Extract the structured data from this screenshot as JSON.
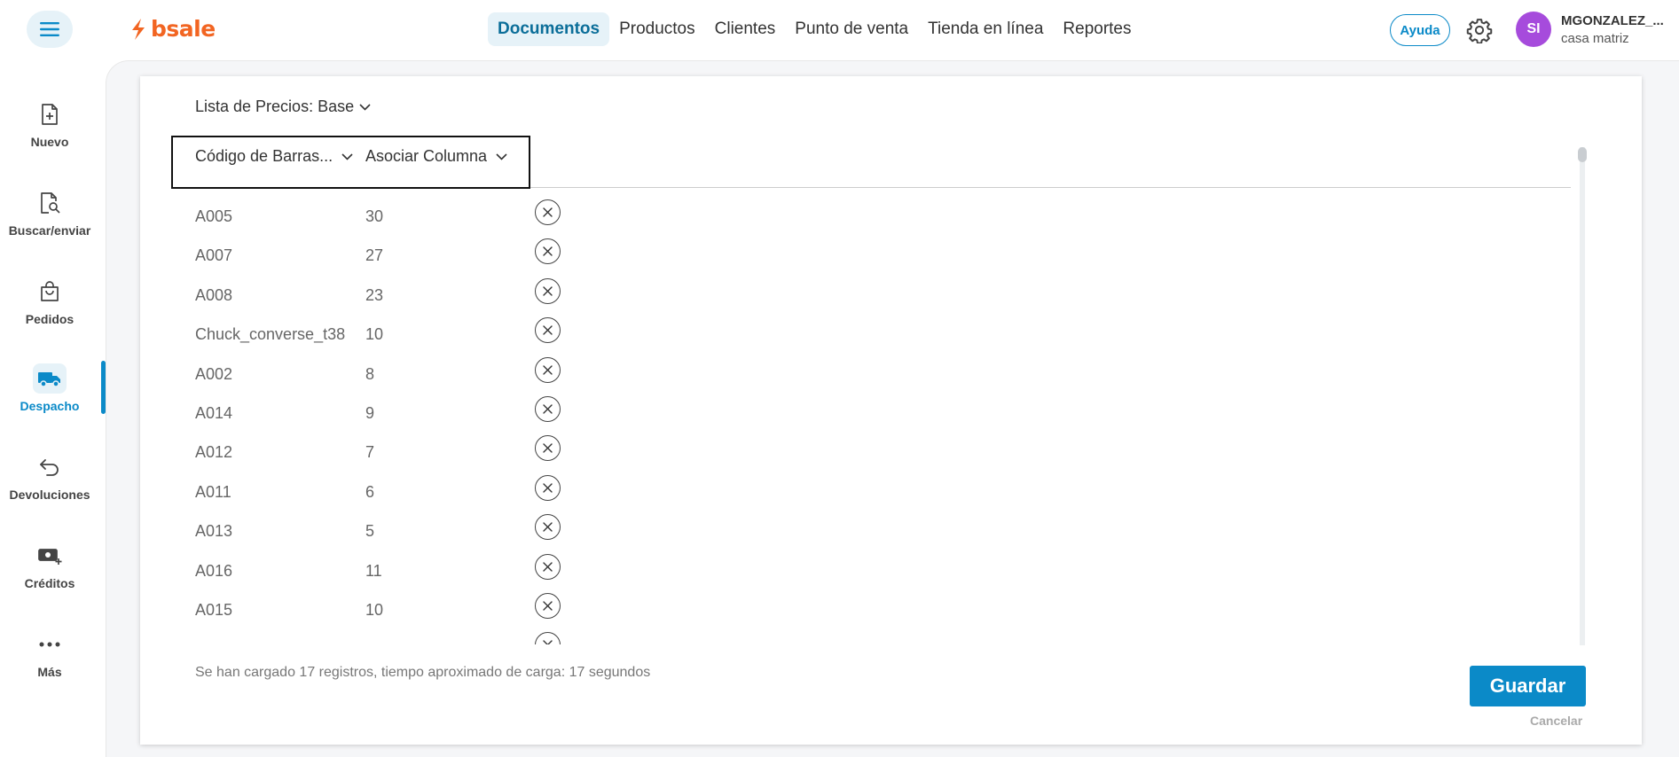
{
  "topbar": {
    "logo_text": "bsale",
    "nav": [
      "Documentos",
      "Productos",
      "Clientes",
      "Punto de venta",
      "Tienda en línea",
      "Reportes"
    ],
    "active_nav": "Documentos",
    "help_label": "Ayuda",
    "user": {
      "initials": "SI",
      "name": "MGONZALEZ_...",
      "branch": "casa matriz"
    }
  },
  "sidebar": {
    "items": [
      {
        "label": "Nuevo",
        "icon": "new-document-icon"
      },
      {
        "label": "Buscar/enviar",
        "icon": "search-document-icon"
      },
      {
        "label": "Pedidos",
        "icon": "shopping-bag-icon"
      },
      {
        "label": "Despacho",
        "icon": "truck-icon"
      },
      {
        "label": "Devoluciones",
        "icon": "return-arrow-icon"
      },
      {
        "label": "Créditos",
        "icon": "cash-plus-icon"
      },
      {
        "label": "Más",
        "icon": "more-dots-icon"
      }
    ],
    "active": "Despacho"
  },
  "main": {
    "price_list_label": "Lista de Precios: Base",
    "columns": {
      "code": "Código de Barras...",
      "associate": "Asociar Columna"
    },
    "rows": [
      {
        "code": "A005",
        "column": "30"
      },
      {
        "code": "A007",
        "column": "27"
      },
      {
        "code": "A008",
        "column": "23"
      },
      {
        "code": "Chuck_converse_t38",
        "column": "10"
      },
      {
        "code": "A002",
        "column": "8"
      },
      {
        "code": "A014",
        "column": "9"
      },
      {
        "code": "A012",
        "column": "7"
      },
      {
        "code": "A011",
        "column": "6"
      },
      {
        "code": "A013",
        "column": "5"
      },
      {
        "code": "A016",
        "column": "11"
      },
      {
        "code": "A015",
        "column": "10"
      }
    ],
    "status_text": "Se han cargado 17 registros, tiempo aproximado de carga: 17 segundos",
    "save_label": "Guardar",
    "cancel_label": "Cancelar"
  },
  "colors": {
    "accent": "#0b8ac8",
    "brand": "#f26522",
    "avatar": "#a64bdc"
  }
}
